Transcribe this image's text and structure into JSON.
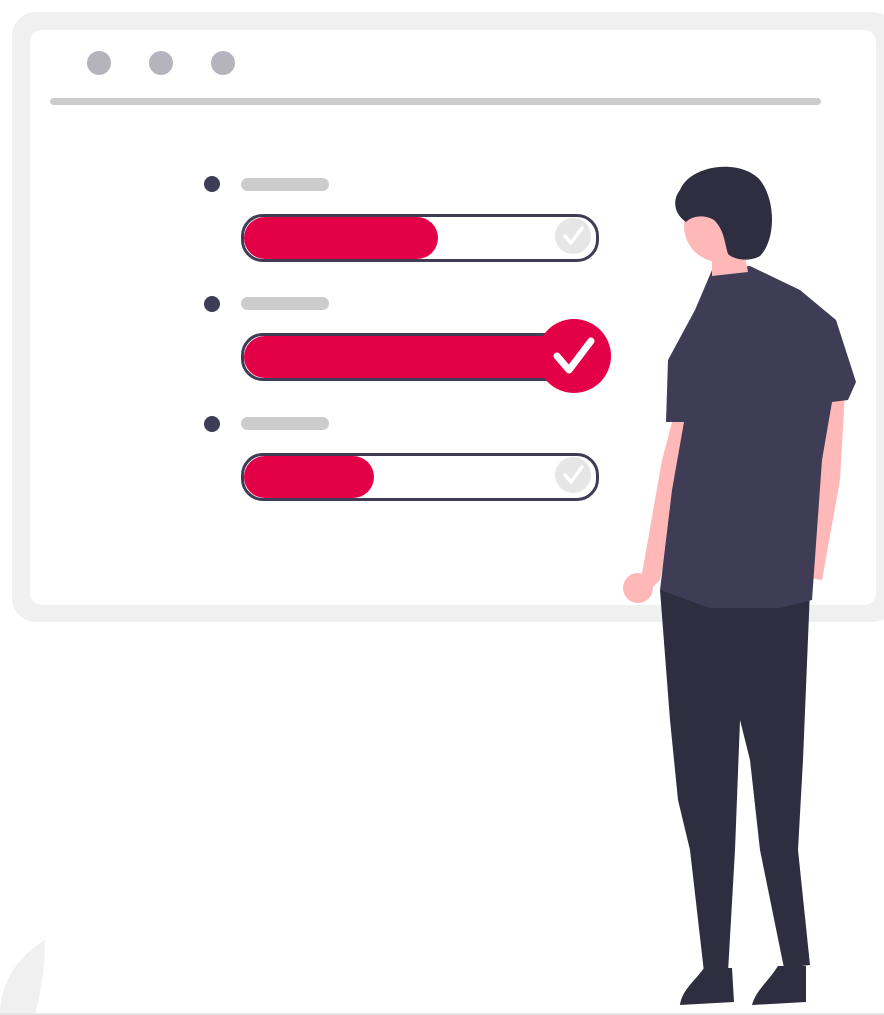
{
  "illustration": {
    "colors": {
      "accent": "#e30047",
      "outline": "#3f3d56",
      "frame": "#f0f0f0",
      "placeholder": "#cccccc",
      "window_dot": "#b5b3bb",
      "check_inactive": "#e6e6e6",
      "shirt": "#3f3d56",
      "pants": "#2f2e41",
      "skin": "#ffb8b8",
      "hair": "#2f2e41"
    },
    "window_controls": [
      "dot",
      "dot",
      "dot"
    ],
    "tasks": [
      {
        "progress": 0.55,
        "completed": false,
        "icon": "check-icon"
      },
      {
        "progress": 1.0,
        "completed": true,
        "icon": "check-icon"
      },
      {
        "progress": 0.37,
        "completed": false,
        "icon": "check-icon"
      }
    ],
    "figure": "person-looking-at-board"
  }
}
